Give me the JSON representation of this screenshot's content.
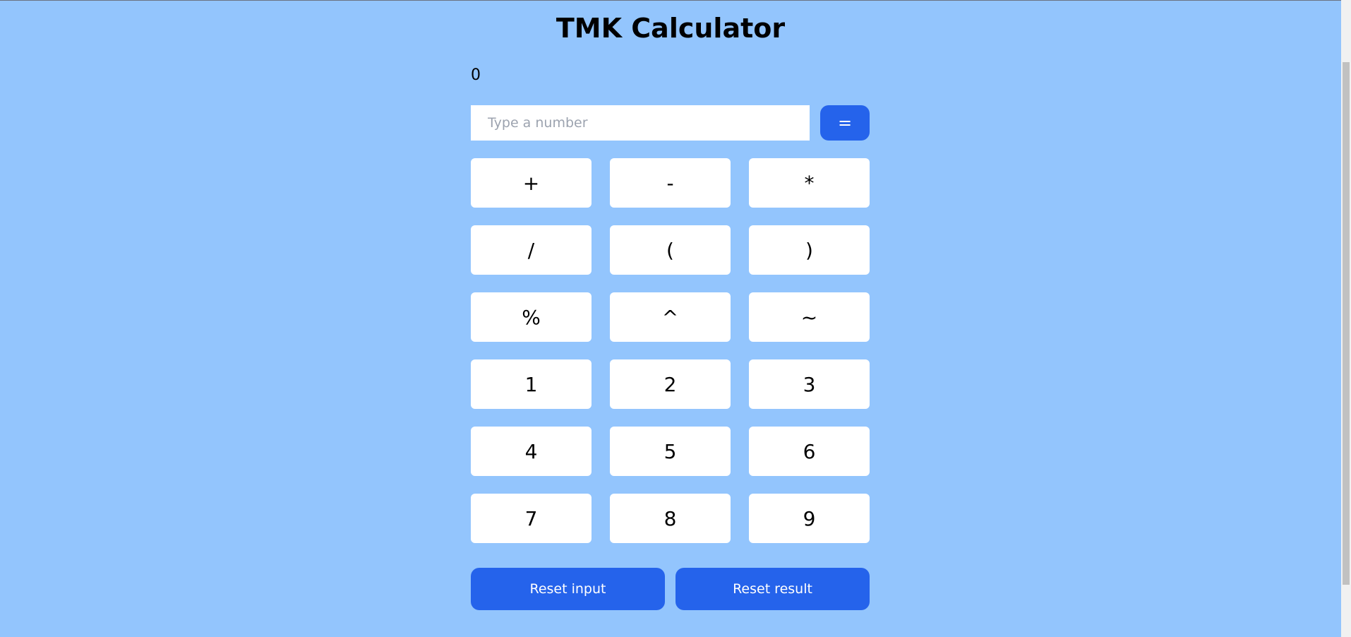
{
  "app": {
    "title": "TMK Calculator"
  },
  "display": {
    "result": "0"
  },
  "input": {
    "value": "",
    "placeholder": "Type a number"
  },
  "buttons": {
    "equals": "=",
    "reset_input": "Reset input",
    "reset_result": "Reset result"
  },
  "keypad": {
    "keys": [
      "+",
      "-",
      "*",
      "/",
      "(",
      ")",
      "%",
      "^",
      "~",
      "1",
      "2",
      "3",
      "4",
      "5",
      "6",
      "7",
      "8",
      "9"
    ]
  },
  "colors": {
    "background": "#93c5fd",
    "accent": "#2563eb",
    "key": "#ffffff"
  }
}
